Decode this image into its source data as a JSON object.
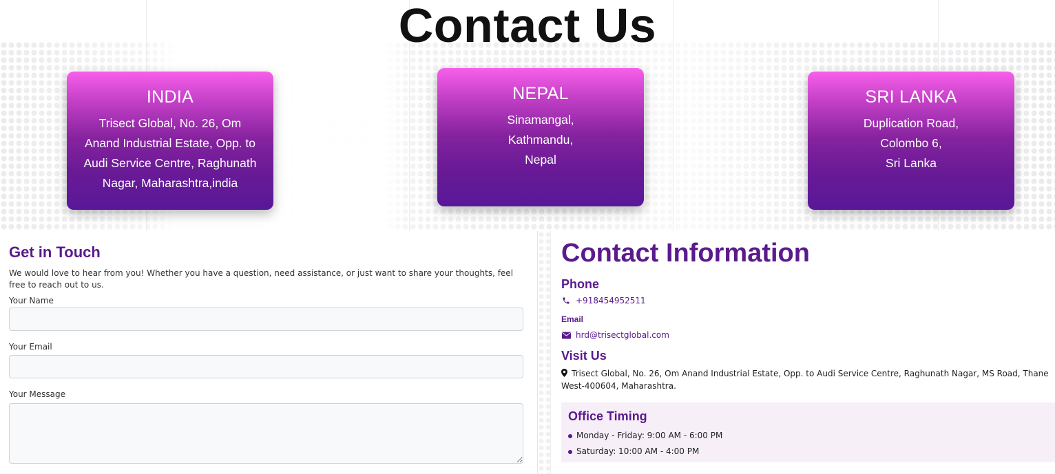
{
  "page": {
    "title": "Contact Us"
  },
  "offices": [
    {
      "country": "INDIA",
      "address_lines": [
        "Trisect Global, No. 26, Om",
        "Anand Industrial Estate, Opp. to",
        "Audi Service Centre, Raghunath",
        "Nagar, Maharashtra,india"
      ]
    },
    {
      "country": "NEPAL",
      "address_lines": [
        "Sinamangal,",
        "Kathmandu,",
        "Nepal"
      ]
    },
    {
      "country": "SRI LANKA",
      "address_lines": [
        "Duplication Road,",
        "Colombo 6,",
        "Sri Lanka"
      ]
    }
  ],
  "form": {
    "title": "Get in Touch",
    "description": "We would love to hear from you! Whether you have a question, need assistance, or just want to share your thoughts, feel free to reach out to us.",
    "name_label": "Your Name",
    "name_value": "",
    "email_label": "Your Email",
    "email_value": "",
    "message_label": "Your Message",
    "message_value": ""
  },
  "contact": {
    "title": "Contact Information",
    "phone_heading": "Phone",
    "phone": "+918454952511",
    "email_heading": "Email",
    "email": "hrd@trisectglobal.com",
    "visit_heading": "Visit Us",
    "address": "Trisect Global, No. 26, Om Anand Industrial Estate, Opp. to Audi Service Centre, Raghunath Nagar, MS Road, Thane West-400604, Maharashtra.",
    "timing_heading": "Office Timing",
    "timings": [
      "Monday - Friday: 9:00 AM - 6:00 PM",
      "Saturday: 10:00 AM - 4:00 PM"
    ]
  },
  "colors": {
    "accent": "#5a1a8c",
    "card_top": "#f75fe9",
    "card_bottom": "#581898",
    "timing_bg": "#f6eff8"
  },
  "icons": [
    "phone-icon",
    "envelope-icon",
    "map-pin-icon"
  ]
}
